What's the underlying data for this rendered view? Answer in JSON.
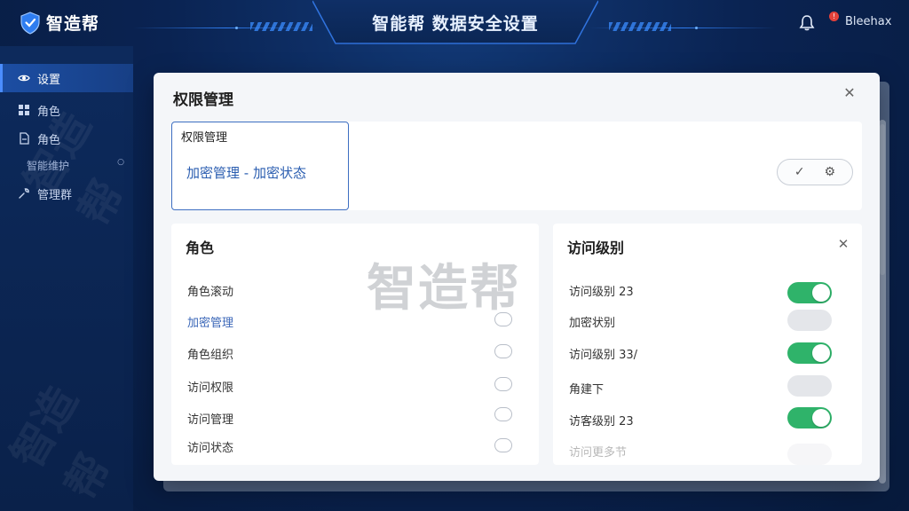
{
  "brand": {
    "name": "智造帮"
  },
  "header": {
    "title": "智能帮 数据安全设置",
    "notification_badge": "!",
    "user": "Bleehax"
  },
  "sidebar": {
    "items": [
      {
        "label": "设置",
        "icon": "eye-icon",
        "active": true
      },
      {
        "label": "角色",
        "icon": "grid-icon",
        "active": false
      },
      {
        "label": "角色",
        "icon": "document-icon",
        "active": false
      },
      {
        "label": "智能维护",
        "sub": true,
        "marker": "○"
      },
      {
        "label": "管理群",
        "icon": "wrench-icon",
        "active": false
      }
    ]
  },
  "watermarks": {
    "center": "智造帮"
  },
  "modal": {
    "title": "权限管理",
    "close": "✕",
    "top_card": {
      "tab_label": "权限管理",
      "path": "加密管理 - 加密状态",
      "check": "✓",
      "settings": "⚙"
    },
    "role_panel": {
      "title": "角色",
      "rows": [
        {
          "label": "角色滚动",
          "link": false,
          "radio": false
        },
        {
          "label": "加密管理",
          "link": true,
          "radio": true
        },
        {
          "label": "角色组织",
          "link": false,
          "radio": true
        },
        {
          "label": "访问权限",
          "link": false,
          "radio": true
        },
        {
          "label": "访问管理",
          "link": false,
          "radio": true
        },
        {
          "label": "访问状态",
          "link": false,
          "radio": true
        }
      ]
    },
    "access_panel": {
      "title": "访问级别",
      "close": "✕",
      "rows": [
        {
          "label": "访问级别 23",
          "on": true
        },
        {
          "label": "加密状别",
          "on": false
        },
        {
          "label": "访问级别 33/",
          "on": true
        },
        {
          "label": "角建下",
          "on": false
        },
        {
          "label": "访客级别 23",
          "on": true
        },
        {
          "label": "访问更多节",
          "on": false,
          "faded": true
        }
      ]
    }
  },
  "colors": {
    "accent": "#2a5db0",
    "toggle_on": "#2fb36a",
    "sidebar_active": "#1c4ea3"
  }
}
